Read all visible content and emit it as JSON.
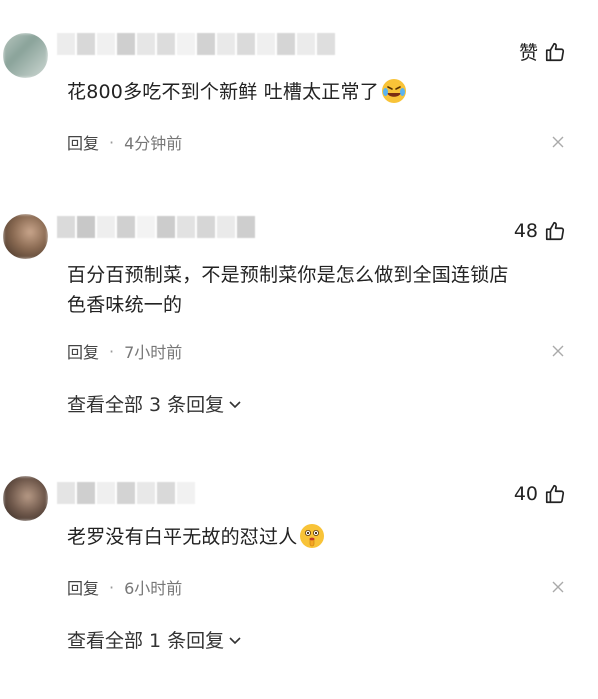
{
  "comments": [
    {
      "likes": "赞",
      "text": "花800多吃不到个新鲜 吐槽太正常了",
      "emoji": "rolling-laughing-emoji",
      "reply_label": "回复",
      "separator": "·",
      "time": "4分钟前"
    },
    {
      "likes": "48",
      "text_line1": "百分百预制菜，不是预制菜你是怎么做到全国连锁店",
      "text_line2": "色香味统一的",
      "reply_label": "回复",
      "separator": "·",
      "time": "7小时前",
      "view_all": "查看全部 3 条回复"
    },
    {
      "likes": "40",
      "text": "老罗没有白平无故的怼过人",
      "emoji": "shushing-face-emoji",
      "reply_label": "回复",
      "separator": "·",
      "time": "6小时前",
      "view_all": "查看全部 1 条回复"
    }
  ],
  "icons": {
    "like": "thumbs-up-icon",
    "close": "close-icon",
    "expand": "chevron-down-icon"
  },
  "colors": {
    "text": "#222222",
    "meta": "#777777",
    "blur_gray": "#d9d9d9"
  }
}
